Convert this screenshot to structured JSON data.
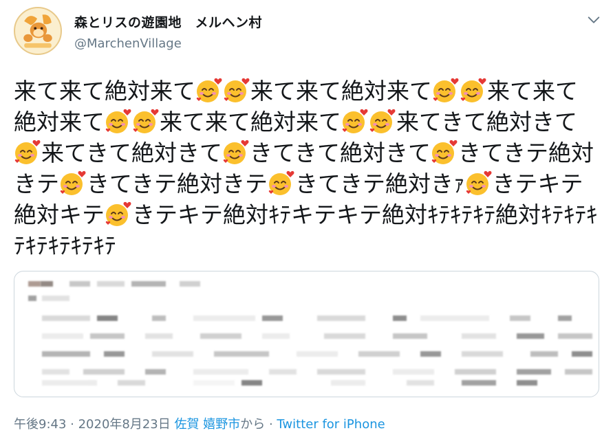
{
  "profile": {
    "display_name": "森とリスの遊園地　メルヘン村",
    "handle": "@MarchenVillage",
    "avatar_icon": "squirrel-logo-icon",
    "avatar_bg": "#fbefcf"
  },
  "tweet": {
    "segments": [
      {
        "text": "来て来て絶対来て"
      },
      {
        "emoji": "smiling-face-with-hearts-icon"
      },
      {
        "emoji": "smiling-face-with-hearts-icon"
      },
      {
        "text": "来て来て絶対来て"
      },
      {
        "emoji": "smiling-face-with-hearts-icon"
      },
      {
        "emoji": "smiling-face-with-hearts-icon"
      },
      {
        "text": "来て来て絶対来て"
      },
      {
        "emoji": "smiling-face-with-hearts-icon"
      },
      {
        "emoji": "smiling-face-with-hearts-icon"
      },
      {
        "text": "来て来て絶対来て"
      },
      {
        "emoji": "smiling-face-with-hearts-icon"
      },
      {
        "emoji": "smiling-face-with-hearts-icon"
      },
      {
        "text": "来てきて絶対きて"
      },
      {
        "emoji": "smiling-face-with-hearts-icon"
      },
      {
        "text": "来てきて絶対きて"
      },
      {
        "emoji": "smiling-face-with-hearts-icon"
      },
      {
        "text": "きてきて絶対きて"
      },
      {
        "emoji": "smiling-face-with-hearts-icon"
      },
      {
        "text": "きてきテ絶対きテ"
      },
      {
        "emoji": "smiling-face-with-hearts-icon"
      },
      {
        "text": "きてきテ絶対きテ"
      },
      {
        "emoji": "smiling-face-with-hearts-icon"
      },
      {
        "text": "きてきテ絶対きｧ"
      },
      {
        "emoji": "smiling-face-with-hearts-icon"
      },
      {
        "text": "きテキテ絶対キテ"
      },
      {
        "emoji": "smiling-face-with-hearts-icon"
      },
      {
        "text": "きテキテ絶対ｷﾃキテキテ絶対ｷﾃｷﾃｷﾃ絶対ｷﾃｷﾃｷﾃｷﾃｷﾃｷﾃｷﾃ"
      }
    ],
    "emoji_colors": {
      "face": "#fbc02d",
      "heart": "#e53935",
      "cheek": "#f48fb1"
    }
  },
  "quoted_card": {
    "blurred": true
  },
  "meta": {
    "timestamp": "午後9:43 · 2020年8月23日",
    "location": "佐賀 嬉野市",
    "from_label": "から",
    "separator": " · ",
    "source": "Twitter for iPhone",
    "link_color": "#1b95e0"
  },
  "menu": {
    "chevron_icon": "chevron-down-icon"
  }
}
